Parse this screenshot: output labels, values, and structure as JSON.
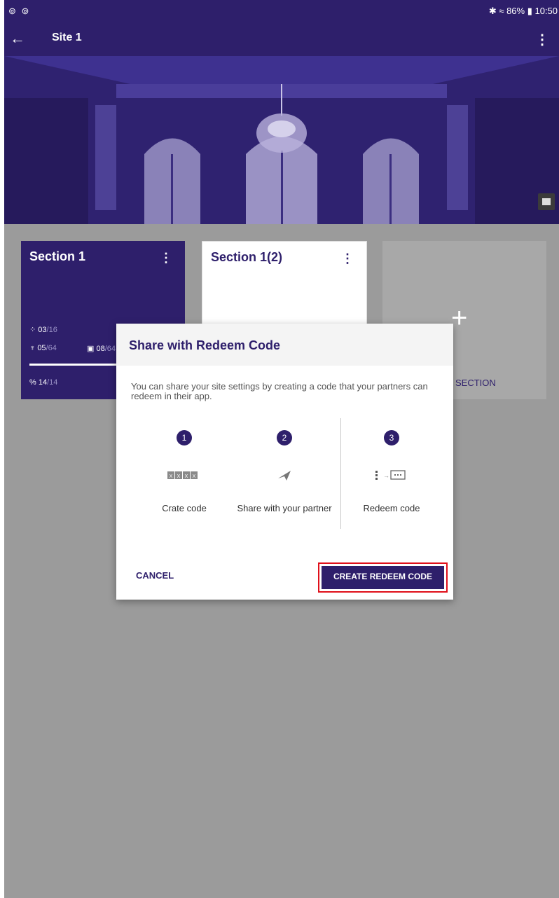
{
  "status_bar": {
    "left_icons": "⊚ ⊚",
    "right_text": "✱ ≈ 86% ▮ 10:50"
  },
  "app_bar": {
    "title": "Site 1",
    "back_icon": "←",
    "menu_icon": "⋮"
  },
  "hero": {
    "image": "ornate-hall-photo",
    "change_image_icon": "image-icon"
  },
  "sections": [
    {
      "title": "Section 1",
      "menu_icon": "⋮",
      "stats": [
        {
          "icon": "sensor-icon",
          "value": "03",
          "total": "/16"
        },
        {
          "icon": "light-icon",
          "value": "05",
          "total": "/64"
        },
        {
          "icon": "device-icon",
          "value": "08",
          "total": "/64"
        },
        {
          "icon": "link-icon",
          "value": "14",
          "total": "/14"
        }
      ]
    },
    {
      "title": "Section 1(2)",
      "menu_icon": "⋮"
    }
  ],
  "add_section": {
    "plus": "+",
    "label": "SECTION"
  },
  "dialog": {
    "title": "Share with Redeem Code",
    "description": "You can share your site settings by creating a code that your partners can redeem in their app.",
    "steps": [
      {
        "number": "1",
        "icon": "code-boxes-icon",
        "icon_text": "X X X X",
        "label": "Crate code"
      },
      {
        "number": "2",
        "icon": "send-icon",
        "label": "Share with your partner"
      },
      {
        "number": "3",
        "icon": "redeem-ticket-icon",
        "label": "Redeem code"
      }
    ],
    "cancel_label": "CANCEL",
    "create_label": "CREATE REDEEM CODE"
  },
  "colors": {
    "primary": "#2e1f6b",
    "overlay": "#9b9b9b",
    "highlight_border": "#e0101a"
  }
}
